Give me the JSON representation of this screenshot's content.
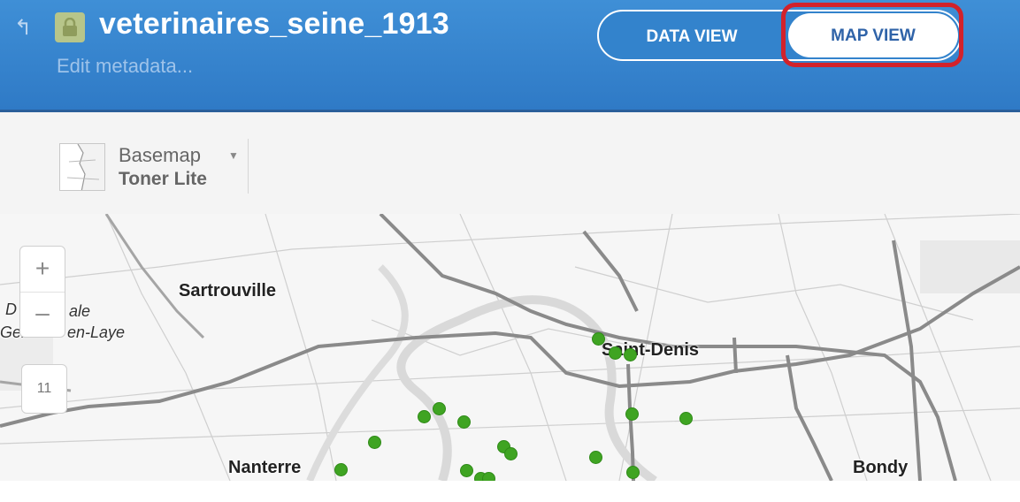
{
  "header": {
    "title": "veterinaires_seine_1913",
    "edit_metadata": "Edit metadata...",
    "data_view_label": "DATA VIEW",
    "map_view_label": "MAP VIEW",
    "active_view": "MAP VIEW",
    "icons": {
      "back": "back-arrow-icon",
      "lock": "lock-icon"
    },
    "colors": {
      "header_bg": "#3383cc",
      "highlight": "#d2222b"
    }
  },
  "toolbar": {
    "basemap_label": "Basemap",
    "basemap_value": "Toner Lite"
  },
  "map": {
    "zoom_in": "+",
    "zoom_out": "–",
    "zoom_level": "11",
    "labels": {
      "sartrouville": "Sartrouville",
      "saint_denis": "Saint-Denis",
      "nanterre": "Nanterre",
      "bondy": "Bondy",
      "partial_1": "D",
      "partial_2": "ale",
      "partial_3": "Ger",
      "partial_4": "en-Laye"
    },
    "point_color": "#3fa422"
  }
}
